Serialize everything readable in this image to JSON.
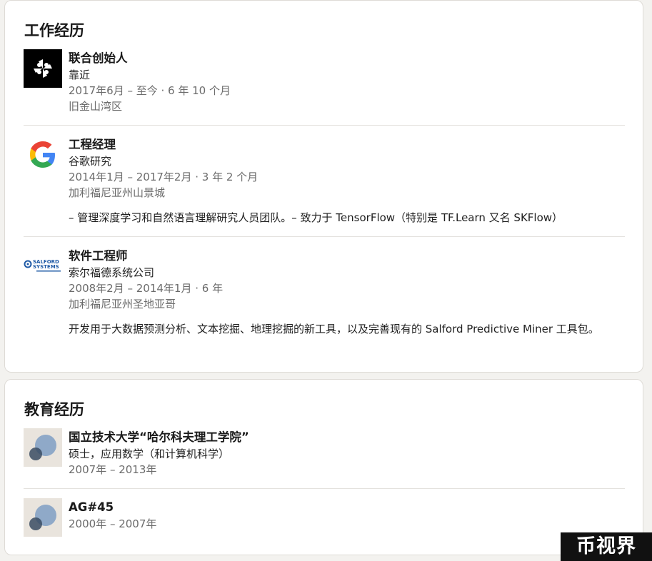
{
  "experience": {
    "title": "工作经历",
    "items": [
      {
        "logo": "startup-pinwheel-logo",
        "role": "联合创始人",
        "company": "靠近",
        "dates": "2017年6月 – 至今 · 6 年 10 个月",
        "location": "旧金山湾区"
      },
      {
        "logo": "google-g-logo",
        "role": "工程经理",
        "company": "谷歌研究",
        "dates": "2014年1月 – 2017年2月 · 3 年 2 个月",
        "location": "加利福尼亚州山景城",
        "description": "– 管理深度学习和自然语言理解研究人员团队。– 致力于 TensorFlow（特别是 TF.Learn 又名 SKFlow）"
      },
      {
        "logo": "salford-systems-logo",
        "logo_text_1": "SALFORD",
        "logo_text_2": "SYSTEMS",
        "role": "软件工程师",
        "company": "索尔福德系统公司",
        "dates": "2008年2月 – 2014年1月 · 6 年",
        "location": "加利福尼亚州圣地亚哥",
        "description": "开发用于大数据预测分析、文本挖掘、地理挖掘的新工具，以及完善现有的 Salford Predictive Miner 工具包。"
      }
    ]
  },
  "education": {
    "title": "教育经历",
    "items": [
      {
        "logo": "school-placeholder-logo",
        "school": "国立技术大学“哈尔科夫理工学院”",
        "degree": "硕士，应用数学（和计算机科学）",
        "dates": "2007年 – 2013年"
      },
      {
        "logo": "school-placeholder-logo",
        "school": "AG#45",
        "dates": "2000年 – 2007年"
      }
    ]
  },
  "watermark": "币视界",
  "colors": {
    "page_bg": "#f3f2ef",
    "card_bg": "#ffffff",
    "muted_text": "#6b6b6b",
    "google_blue": "#4285F4",
    "google_red": "#EA4335",
    "google_yellow": "#FBBC05",
    "google_green": "#34A853",
    "salford_blue": "#1f5aa6"
  }
}
